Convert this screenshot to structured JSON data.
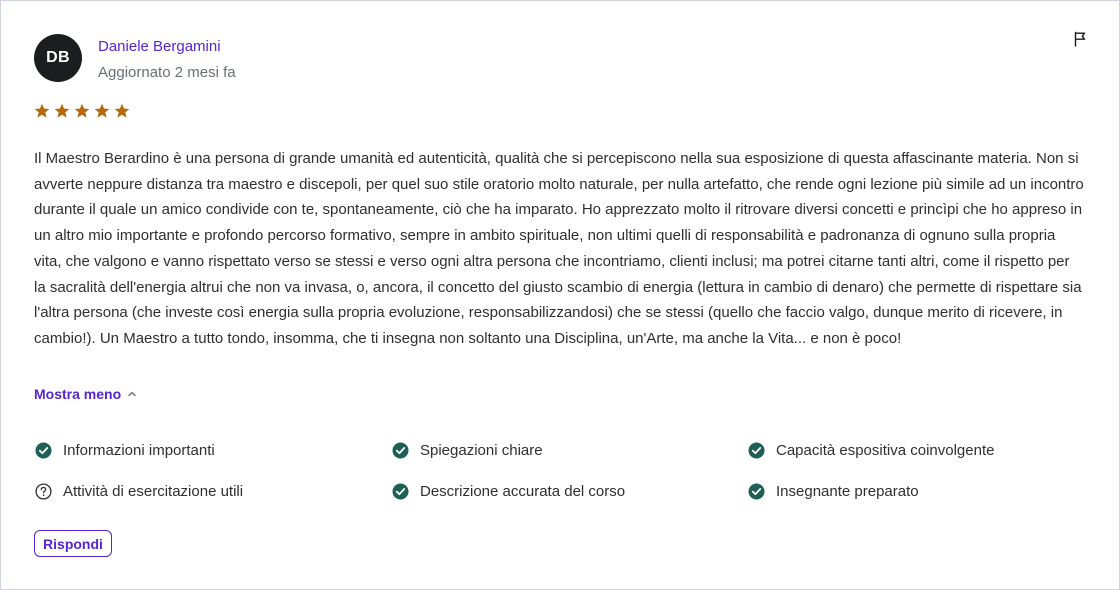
{
  "reviewer": {
    "initials": "DB",
    "name": "Daniele Bergamini",
    "updated": "Aggiornato 2 mesi fa"
  },
  "rating": {
    "value": 5,
    "max": 5,
    "color": "#b4690e"
  },
  "review_text": "Il Maestro Berardino è una persona di grande umanità ed autenticità, qualità che si percepiscono nella sua esposizione di questa affascinante materia. Non si avverte neppure distanza tra maestro e discepoli, per quel suo stile oratorio molto naturale, per nulla artefatto, che rende ogni lezione più simile ad un incontro durante il quale un amico condivide con te, spontaneamente, ciò che ha imparato. Ho apprezzato molto il ritrovare diversi concetti e princìpi che ho appreso in un altro mio importante e profondo percorso formativo, sempre in ambito spirituale, non ultimi quelli di responsabilità e padronanza di ognuno sulla propria vita, che valgono e vanno rispettato verso se stessi e verso ogni altra persona che incontriamo, clienti inclusi; ma potrei citarne tanti altri, come il rispetto per la sacralità dell'energia altrui che non va invasa, o, ancora, il concetto del giusto scambio di energia (lettura in cambio di denaro) che permette di rispettare sia l'altra persona (che investe così energia sulla propria evoluzione, responsabilizzandosi) che se stessi (quello che faccio valgo, dunque merito di ricevere, in cambio!). Un Maestro a tutto tondo, insomma, che ti insegna non soltanto una Disciplina, un'Arte, ma anche la Vita... e non è poco!",
  "show_less": "Mostra meno",
  "attributes": [
    {
      "label": "Informazioni importanti",
      "status": "check"
    },
    {
      "label": "Spiegazioni chiare",
      "status": "check"
    },
    {
      "label": "Capacità espositiva coinvolgente",
      "status": "check"
    },
    {
      "label": "Attività di esercitazione utili",
      "status": "question"
    },
    {
      "label": "Descrizione accurata del corso",
      "status": "check"
    },
    {
      "label": "Insegnante preparato",
      "status": "check"
    }
  ],
  "reply_label": "Rispondi",
  "colors": {
    "brand": "#5624d0",
    "check": "#1e6055",
    "avatar_bg": "#1c1d1f"
  }
}
